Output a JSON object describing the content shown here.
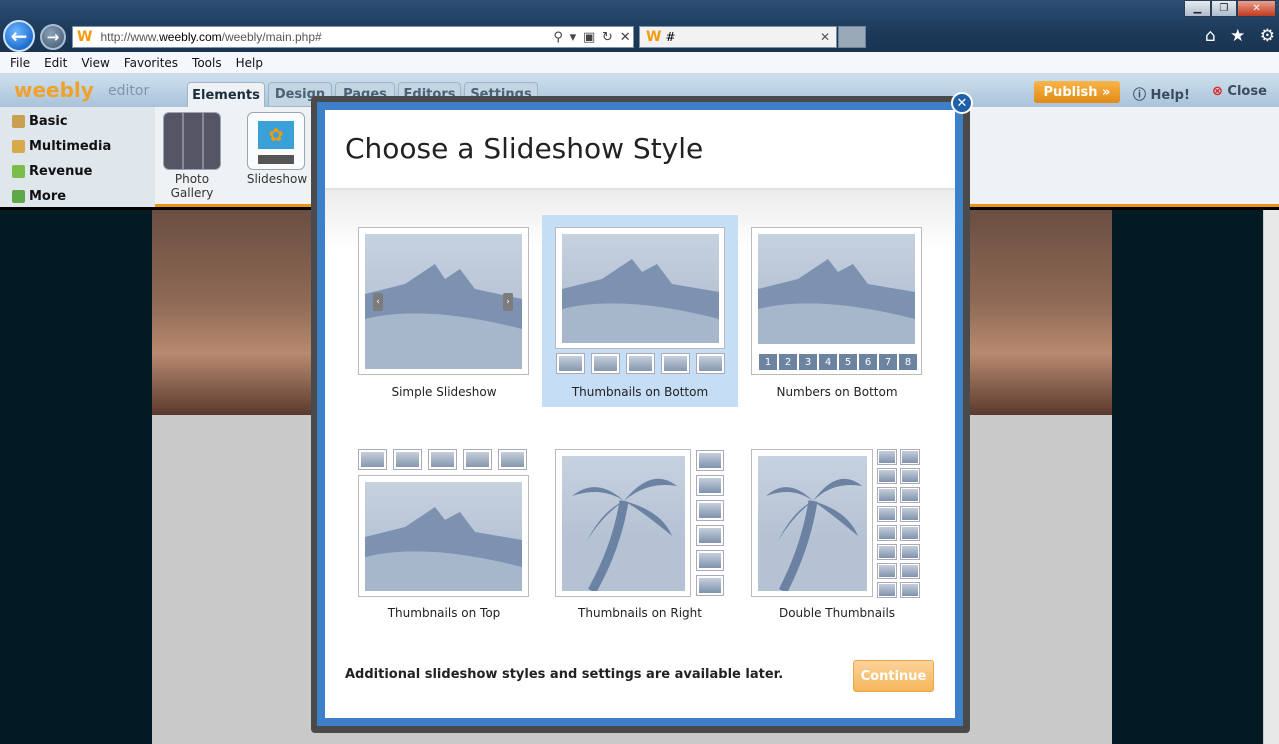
{
  "browser": {
    "address": {
      "prefix": "http://www.",
      "domain": "weebly.com",
      "path": "/weebly/main.php#"
    },
    "tab_title": "#",
    "menu": [
      "File",
      "Edit",
      "View",
      "Favorites",
      "Tools",
      "Help"
    ]
  },
  "editor": {
    "logo": "weebly",
    "logo_sub": "editor",
    "tabs": [
      "Elements",
      "Design",
      "Pages",
      "Editors",
      "Settings"
    ],
    "publish_label": "Publish »",
    "help_label": "Help!",
    "close_label": "Close",
    "categories": [
      "Basic",
      "Multimedia",
      "Revenue",
      "More"
    ],
    "elements": {
      "photo_gallery": "Photo Gallery",
      "slideshow": "Slideshow"
    }
  },
  "modal": {
    "title": "Choose a Slideshow Style",
    "options": [
      {
        "label": "Simple Slideshow"
      },
      {
        "label": "Thumbnails on Bottom",
        "selected": true
      },
      {
        "label": "Numbers on Bottom"
      },
      {
        "label": "Thumbnails on Top"
      },
      {
        "label": "Thumbnails on Right"
      },
      {
        "label": "Double Thumbnails"
      }
    ],
    "numbers": [
      "1",
      "2",
      "3",
      "4",
      "5",
      "6",
      "7",
      "8"
    ],
    "note": "Additional slideshow styles and settings are available later.",
    "continue_label": "Continue"
  },
  "colors": {
    "accent": "#3d7fc8",
    "selected": "#c6ddf6",
    "publish": "#f0a12c"
  }
}
